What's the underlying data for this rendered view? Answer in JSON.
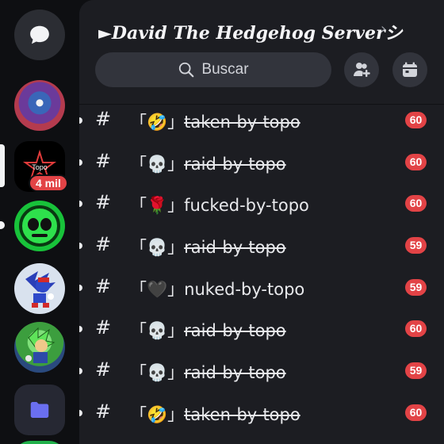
{
  "server": {
    "title": "►David The Hedgehog Serverシ",
    "chevron": "›"
  },
  "search": {
    "label": "Buscar",
    "icon": "search-icon"
  },
  "header_buttons": [
    {
      "icon": "invite-members-icon"
    },
    {
      "icon": "events-calendar-icon"
    }
  ],
  "rail": {
    "selected_server_badge": "4 mil",
    "server_logo_text": "Topo",
    "colors": {
      "badge": "#e24346",
      "rail_bg": "#0e0f12",
      "panel_bg": "#1c1d22"
    }
  },
  "channels": [
    {
      "hash": "#",
      "open": "「",
      "emoji": "🤣",
      "close": "」",
      "name": "taken-by-topo",
      "struck": true,
      "unread": "60"
    },
    {
      "hash": "#",
      "open": "「",
      "emoji": "💀",
      "close": "」",
      "name": "raid-by-topo",
      "struck": true,
      "unread": "60"
    },
    {
      "hash": "#",
      "open": "「",
      "emoji": "🌹",
      "close": "」",
      "name": "fucked-by-topo",
      "struck": false,
      "unread": "60"
    },
    {
      "hash": "#",
      "open": "「",
      "emoji": "💀",
      "close": "」",
      "name": "raid-by-topo",
      "struck": true,
      "unread": "59"
    },
    {
      "hash": "#",
      "open": "「",
      "emoji": "🖤",
      "close": "」",
      "name": "nuked-by-topo",
      "struck": false,
      "unread": "59"
    },
    {
      "hash": "#",
      "open": "「",
      "emoji": "💀",
      "close": "」",
      "name": "raid-by-topo",
      "struck": true,
      "unread": "60"
    },
    {
      "hash": "#",
      "open": "「",
      "emoji": "💀",
      "close": "」",
      "name": "raid-by-topo",
      "struck": true,
      "unread": "59"
    },
    {
      "hash": "#",
      "open": "「",
      "emoji": "🤣",
      "close": "」",
      "name": "taken-by-topo",
      "struck": true,
      "unread": "60"
    }
  ]
}
